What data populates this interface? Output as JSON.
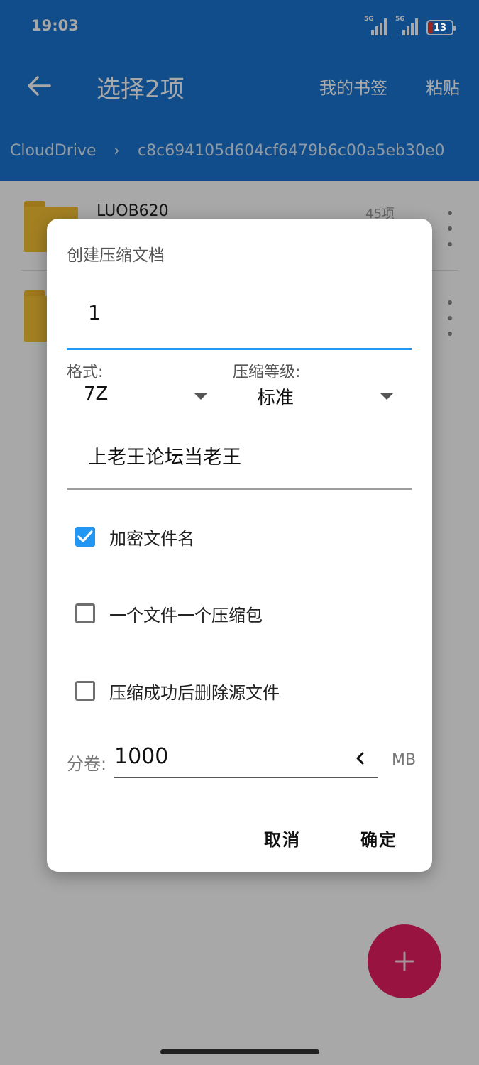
{
  "status": {
    "time": "19:03",
    "signal1_label": "5G",
    "signal2_label": "5G",
    "battery": "13"
  },
  "toolbar": {
    "back_icon": "arrow-left-icon",
    "title": "选择2项",
    "bookmarks_label": "我的书签",
    "paste_label": "粘贴"
  },
  "breadcrumb": {
    "items": [
      "CloudDrive",
      "c8c694105d604cf6479b6c00a5eb30e0"
    ],
    "separator": "›"
  },
  "files": [
    {
      "name": "LUOB620",
      "count": "45项"
    },
    {
      "name": "",
      "count": ""
    }
  ],
  "dialog": {
    "title": "创建压缩文档",
    "archive_name": "1",
    "format_label": "格式:",
    "format_value": "7Z",
    "level_label": "压缩等级:",
    "level_value": "标准",
    "password": "上老王论坛当老王",
    "checkboxes": [
      {
        "label": "加密文件名",
        "checked": true
      },
      {
        "label": "一个文件一个压缩包",
        "checked": false
      },
      {
        "label": "压缩成功后删除源文件",
        "checked": false
      }
    ],
    "volume_label": "分卷:",
    "volume_value": "1000",
    "volume_unit": "MB",
    "cancel_label": "取消",
    "ok_label": "确定"
  },
  "fab": {
    "icon": "plus-icon"
  },
  "colors": {
    "primary": "#1976d2",
    "accent": "#2196f3",
    "fab": "#e91e63",
    "folder": "#f8c234"
  }
}
